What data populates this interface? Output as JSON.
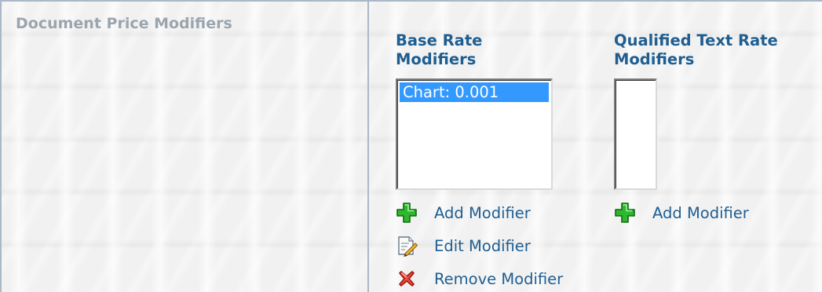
{
  "section": {
    "label": "Document Price Modifiers"
  },
  "base_rate": {
    "title_line1": "Base Rate",
    "title_line2": "Modifiers",
    "list_items": [
      "Chart: 0.001"
    ],
    "add_label": "Add Modifier",
    "edit_label": "Edit Modifier",
    "remove_label": "Remove Modifier"
  },
  "qualified_text_rate": {
    "title_line1": "Qualified Text Rate",
    "title_line2": "Modifiers",
    "list_items": [],
    "add_label": "Add Modifier"
  },
  "colors": {
    "title": "#1f5e91",
    "link": "#1f5e91",
    "section_label": "#9aa5af",
    "selection": "#3399ff",
    "border": "#a9b8c6"
  },
  "icons": {
    "add": "plus-icon",
    "edit": "edit-document-icon",
    "remove": "red-x-icon"
  }
}
